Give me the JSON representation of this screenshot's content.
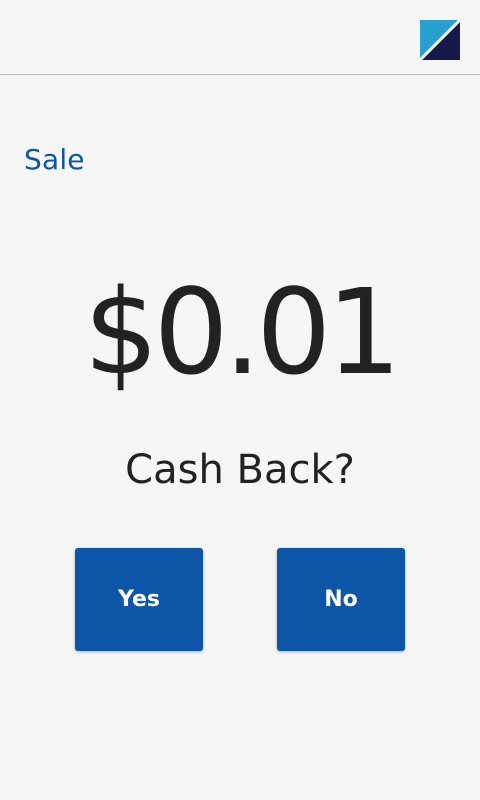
{
  "header": {
    "logo_icon": "split-triangle-logo-icon",
    "logo_colors": {
      "light": "#2aa0cf",
      "dark": "#18184a"
    }
  },
  "transaction": {
    "type": "Sale",
    "amount": "$0.01"
  },
  "prompt": {
    "question": "Cash Back?"
  },
  "actions": {
    "yes_label": "Yes",
    "no_label": "No"
  },
  "colors": {
    "background": "#f6f6f6",
    "accent": "#0d55a6",
    "button_text": "#ffffff",
    "body_text": "#222222",
    "divider": "#bdbdbd"
  }
}
